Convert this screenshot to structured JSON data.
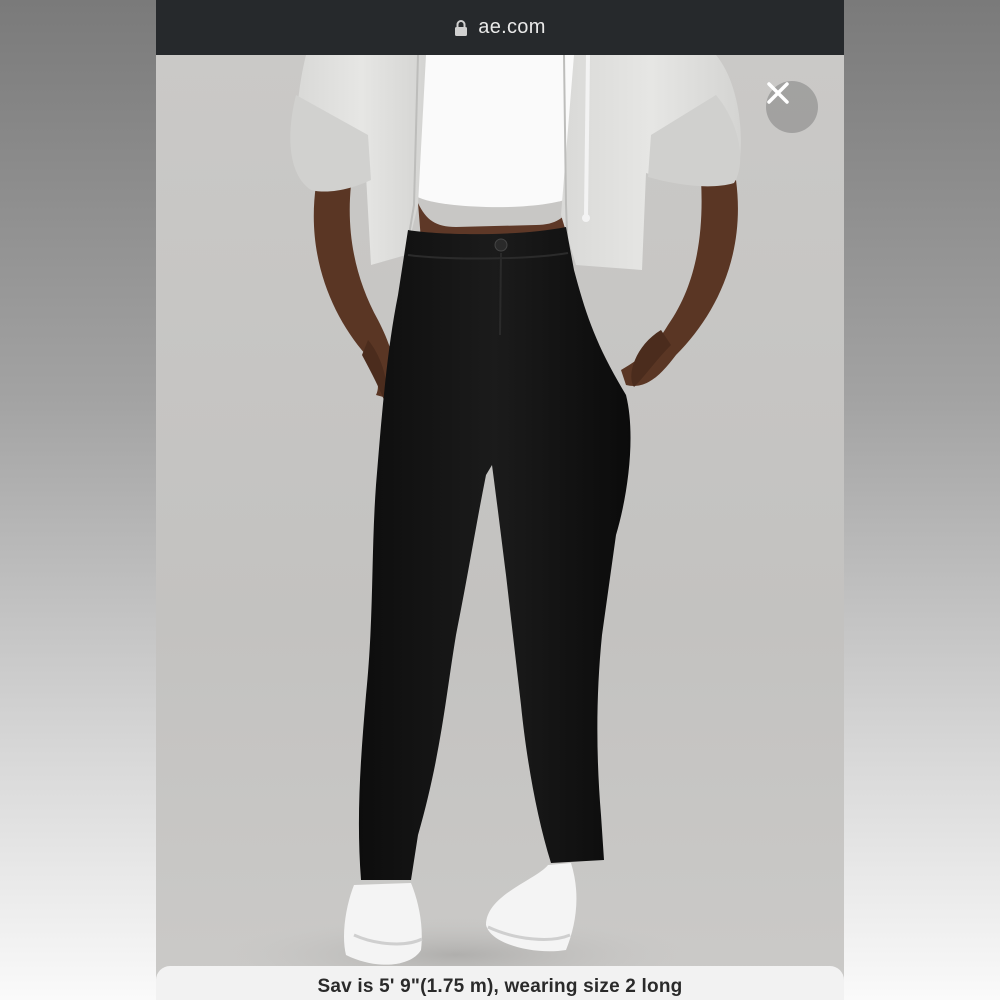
{
  "browser": {
    "url": "ae.com"
  },
  "product_view": {
    "image_alt": "Model wearing black high-waisted skinny jeans, white crop top, grey zip hoodie and white sneakers",
    "caption": "Sav is 5' 9\"(1.75 m), wearing size 2 long"
  },
  "icons": {
    "lock": "lock-icon",
    "close": "close-icon"
  },
  "colors": {
    "url_bar_bg": "#26292c",
    "backdrop": "#c4c3c1",
    "jeans": "#121212",
    "hoodie": "#dcdcda",
    "caption_bg": "#f2f2f2"
  }
}
